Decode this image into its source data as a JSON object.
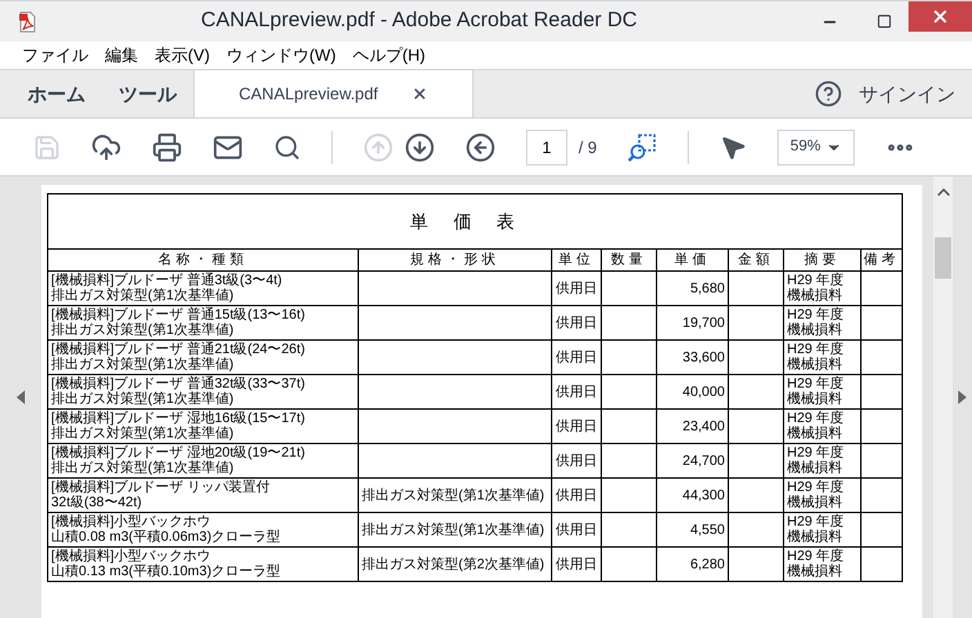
{
  "window": {
    "title": "CANALpreview.pdf - Adobe Acrobat Reader DC"
  },
  "menu": [
    "ファイル",
    "編集",
    "表示(V)",
    "ウィンドウ(W)",
    "ヘルプ(H)"
  ],
  "tabs": [
    {
      "label": "ホーム",
      "kind": "nav",
      "selected": false
    },
    {
      "label": "ツール",
      "kind": "nav",
      "selected": false
    },
    {
      "label": "CANALpreview.pdf",
      "kind": "document",
      "selected": true
    }
  ],
  "sign_in": "サインイン",
  "toolbar": {
    "save_disabled": true,
    "previous_page_disabled": true,
    "page": "1",
    "page_total": "/ 9",
    "zoom": "59%"
  },
  "document": {
    "title": "単価表",
    "columns": [
      "名称・種類",
      "規格・形状",
      "単位",
      "数量",
      "単価",
      "金額",
      "摘要",
      "備考"
    ],
    "rows": [
      {
        "name": [
          "[機械損料]ブルドーザ 普通3t級(3〜4t)",
          "排出ガス対策型(第1次基準値)"
        ],
        "unit": "供用日",
        "price": "5,680",
        "summary": [
          "H29 年度",
          "機械損料"
        ]
      },
      {
        "name": [
          "[機械損料]ブルドーザ 普通15t級(13〜16t)",
          "排出ガス対策型(第1次基準値)"
        ],
        "unit": "供用日",
        "price": "19,700",
        "summary": [
          "H29 年度",
          "機械損料"
        ]
      },
      {
        "name": [
          "[機械損料]ブルドーザ 普通21t級(24〜26t)",
          "排出ガス対策型(第1次基準値)"
        ],
        "unit": "供用日",
        "price": "33,600",
        "summary": [
          "H29 年度",
          "機械損料"
        ]
      },
      {
        "name": [
          "[機械損料]ブルドーザ 普通32t級(33〜37t)",
          "排出ガス対策型(第1次基準値)"
        ],
        "unit": "供用日",
        "price": "40,000",
        "summary": [
          "H29 年度",
          "機械損料"
        ]
      },
      {
        "name": [
          "[機械損料]ブルドーザ 湿地16t級(15〜17t)",
          "排出ガス対策型(第1次基準値)"
        ],
        "unit": "供用日",
        "price": "23,400",
        "summary": [
          "H29 年度",
          "機械損料"
        ]
      },
      {
        "name": [
          "[機械損料]ブルドーザ 湿地20t級(19〜21t)",
          "排出ガス対策型(第1次基準値)"
        ],
        "unit": "供用日",
        "price": "24,700",
        "summary": [
          "H29 年度",
          "機械損料"
        ]
      },
      {
        "name": [
          "[機械損料]ブルドーザ リッパ装置付",
          "32t級(38〜42t)"
        ],
        "spec": "排出ガス対策型(第1次基準値)",
        "unit": "供用日",
        "price": "44,300",
        "summary": [
          "H29 年度",
          "機械損料"
        ]
      },
      {
        "name": [
          "[機械損料]小型バックホウ",
          "山積0.08 m3(平積0.06m3)クローラ型"
        ],
        "spec": "排出ガス対策型(第1次基準値)",
        "unit": "供用日",
        "price": "4,550",
        "summary": [
          "H29 年度",
          "機械損料"
        ]
      },
      {
        "name": [
          "[機械損料]小型バックホウ",
          "山積0.13 m3(平積0.10m3)クローラ型"
        ],
        "spec": "排出ガス対策型(第2次基準値)",
        "unit": "供用日",
        "price": "6,280",
        "summary": [
          "H29 年度",
          "機械損料"
        ]
      }
    ]
  }
}
